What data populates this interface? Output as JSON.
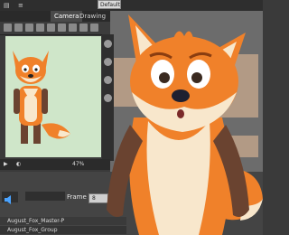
{
  "menu": {
    "default_label": "Default"
  },
  "tabs": [
    {
      "label": "Camera"
    },
    {
      "label": "Drawing"
    }
  ],
  "status": {
    "zoom": "47%"
  },
  "timeline": {
    "frame_label": "Frame",
    "frame_value": "8",
    "layers": [
      "August_Fox_Master-P",
      "August_Fox_Group"
    ]
  },
  "colors": {
    "fox_orange": "#f0812a",
    "fox_cream": "#f8e7cc",
    "fox_brown": "#6a4330",
    "canvas_bg": "#cfe6c9",
    "ui_dark": "#3a3a3a"
  }
}
